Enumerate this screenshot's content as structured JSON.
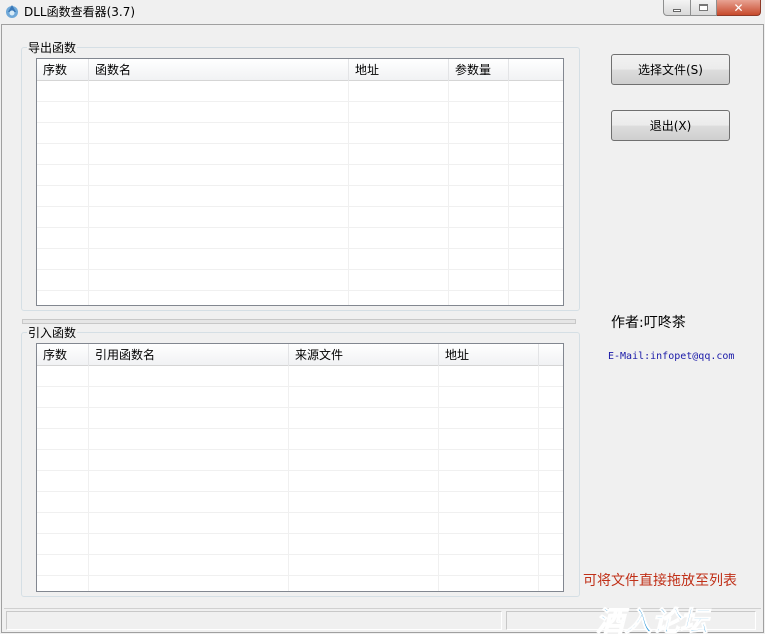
{
  "window": {
    "title": "DLL函数查看器(3.7)",
    "close_glyph": "✕"
  },
  "export_group": {
    "label": "导出函数",
    "columns": [
      "序数",
      "函数名",
      "地址",
      "参数量"
    ]
  },
  "import_group": {
    "label": "引入函数",
    "columns": [
      "序数",
      "引用函数名",
      "来源文件",
      "地址"
    ]
  },
  "buttons": {
    "select_file": "选择文件(S)",
    "exit": "退出(X)"
  },
  "info": {
    "author": "作者:叮咚茶",
    "email": "E-Mail:infopet@qq.com",
    "drag_hint": "可将文件直接拖放至列表"
  },
  "watermark": {
    "text": "酒入论坛"
  },
  "colors": {
    "hint_text": "#c03018",
    "email_text": "#1a1aa8",
    "close_button": "#c74a2c",
    "watermark": "#1f8fd6"
  },
  "icons": {
    "app": "app-icon",
    "minimize": "minimize-icon",
    "maximize": "maximize-icon",
    "close": "close-icon"
  }
}
